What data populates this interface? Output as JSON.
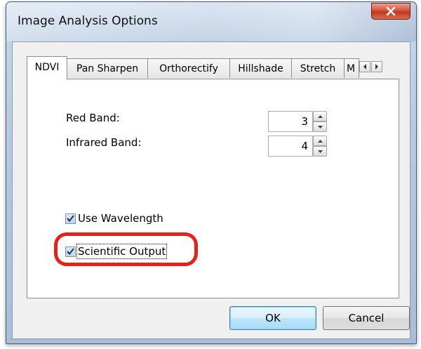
{
  "window": {
    "title": "Image Analysis Options"
  },
  "tabs": [
    {
      "label": "NDVI",
      "active": true
    },
    {
      "label": "Pan Sharpen",
      "active": false
    },
    {
      "label": "Orthorectify",
      "active": false
    },
    {
      "label": "Hillshade",
      "active": false
    },
    {
      "label": "Stretch",
      "active": false
    },
    {
      "label": "M",
      "active": false
    }
  ],
  "ndvi": {
    "red_band": {
      "label": "Red Band:",
      "value": "3"
    },
    "infrared_band": {
      "label": "Infrared Band:",
      "value": "4"
    },
    "use_wavelength": {
      "label": "Use Wavelength",
      "checked": true
    },
    "scientific_output": {
      "label": "Scientific Output",
      "checked": true
    }
  },
  "buttons": {
    "ok": "OK",
    "cancel": "Cancel"
  },
  "colors": {
    "highlight": "#e8201a",
    "close_button": "#c0391f",
    "default_button_border": "#3c7fb1"
  }
}
